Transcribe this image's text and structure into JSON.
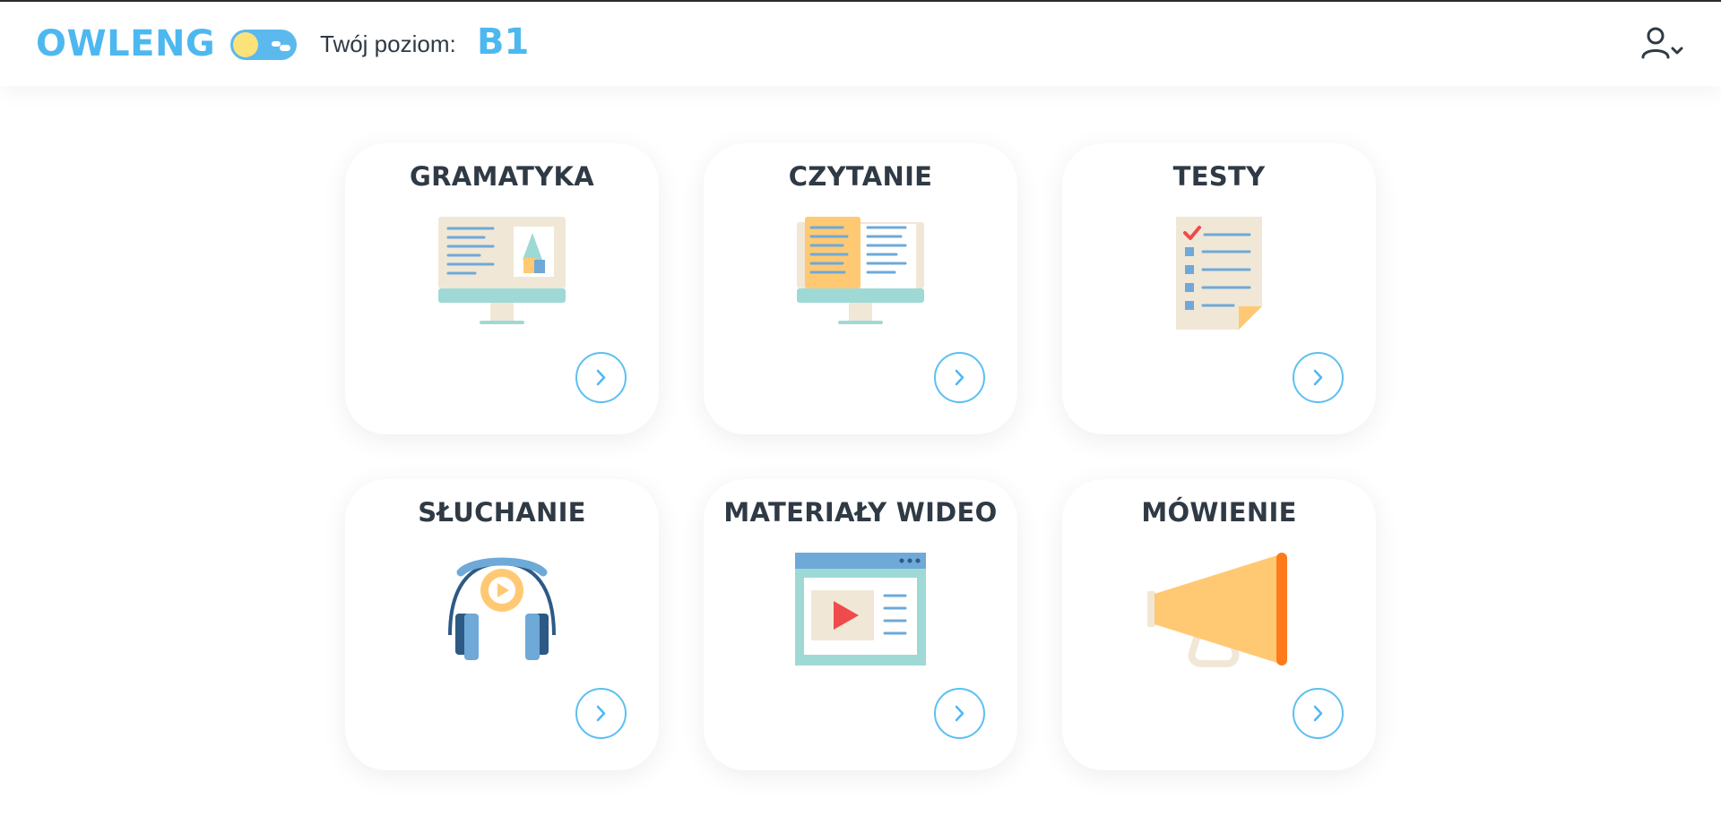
{
  "header": {
    "logo": "OWLENG",
    "theme_toggle": {
      "state": "light",
      "icons": [
        "sun-icon",
        "cloud-icon"
      ]
    },
    "level_label": "Twój poziom:",
    "level_value": "B1",
    "user_menu_icon": "user-chevron-icon"
  },
  "colors": {
    "accent": "#4db8f0",
    "text": "#2f3a45",
    "button_border": "#5cc0f2"
  },
  "cards": [
    {
      "title": "GRAMATYKA",
      "icon": "monitor-grammar-icon"
    },
    {
      "title": "CZYTANIE",
      "icon": "monitor-book-icon"
    },
    {
      "title": "TESTY",
      "icon": "checklist-icon"
    },
    {
      "title": "SŁUCHANIE",
      "icon": "headphones-icon"
    },
    {
      "title": "MATERIAŁY WIDEO",
      "icon": "video-player-icon"
    },
    {
      "title": "MÓWIENIE",
      "icon": "megaphone-icon"
    }
  ]
}
